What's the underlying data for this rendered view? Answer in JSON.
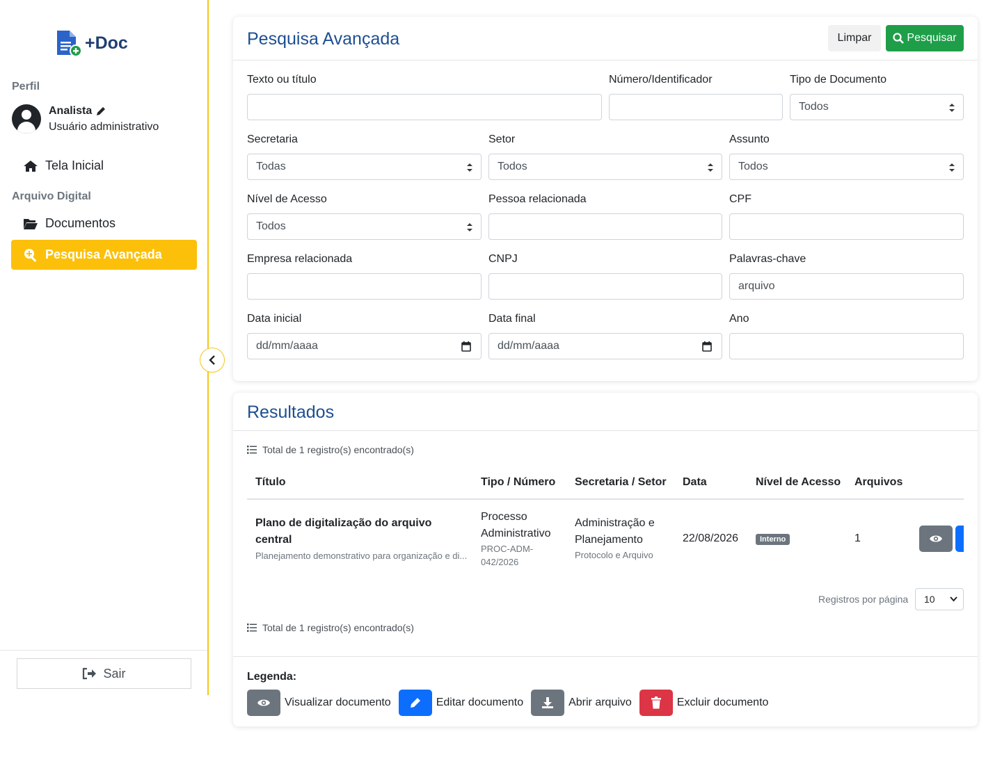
{
  "app": {
    "name": "+Doc"
  },
  "sidebar": {
    "profile_heading": "Perfil",
    "user_name": "Analista",
    "user_role": "Usuário administrativo",
    "home": "Tela Inicial",
    "section_heading": "Arquivo Digital",
    "documents": "Documentos",
    "advanced_search": "Pesquisa Avançada",
    "logout": "Sair"
  },
  "search": {
    "title": "Pesquisa Avançada",
    "clear_label": "Limpar",
    "search_label": "Pesquisar",
    "fields": {
      "text_label": "Texto ou título",
      "text_value": "",
      "number_label": "Número/Identificador",
      "number_value": "",
      "doctype_label": "Tipo de Documento",
      "doctype_value": "Todos",
      "secretaria_label": "Secretaria",
      "secretaria_value": "Todas",
      "setor_label": "Setor",
      "setor_value": "Todos",
      "assunto_label": "Assunto",
      "assunto_value": "Todos",
      "nivel_label": "Nível de Acesso",
      "nivel_value": "Todos",
      "pessoa_label": "Pessoa relacionada",
      "pessoa_value": "",
      "cpf_label": "CPF",
      "cpf_value": "",
      "empresa_label": "Empresa relacionada",
      "empresa_value": "",
      "cnpj_label": "CNPJ",
      "cnpj_value": "",
      "keywords_label": "Palavras-chave",
      "keywords_value": "arquivo",
      "date_start_label": "Data inicial",
      "date_start_value": "dd/mm/aaaa",
      "date_end_label": "Data final",
      "date_end_value": "dd/mm/aaaa",
      "year_label": "Ano",
      "year_value": ""
    }
  },
  "results": {
    "title": "Resultados",
    "summary": "Total de 1 registro(s) encontrado(s)",
    "columns": [
      "Título",
      "Tipo / Número",
      "Secretaria / Setor",
      "Data",
      "Nível de Acesso",
      "Arquivos"
    ],
    "rows": [
      {
        "title": "Plano de digitalização do arquivo central",
        "description": "Planejamento demonstrativo para organização e di...",
        "type": "Processo Administrativo",
        "number": "PROC-ADM-042/2026",
        "secretaria": "Administração e Planejamento",
        "setor": "Protocolo e Arquivo",
        "date": "22/08/2026",
        "access": "Interno",
        "files": "1"
      }
    ],
    "per_page_label": "Registros por página",
    "per_page_value": "10"
  },
  "legend": {
    "title": "Legenda:",
    "view": "Visualizar documento",
    "edit": "Editar documento",
    "open": "Abrir arquivo",
    "delete": "Excluir documento"
  },
  "colors": {
    "accent": "#fcc00a",
    "title_blue": "#1d4f91",
    "success": "#1e9e49",
    "secondary": "#6c757d",
    "primary": "#0d6efd",
    "danger": "#dc3545"
  }
}
